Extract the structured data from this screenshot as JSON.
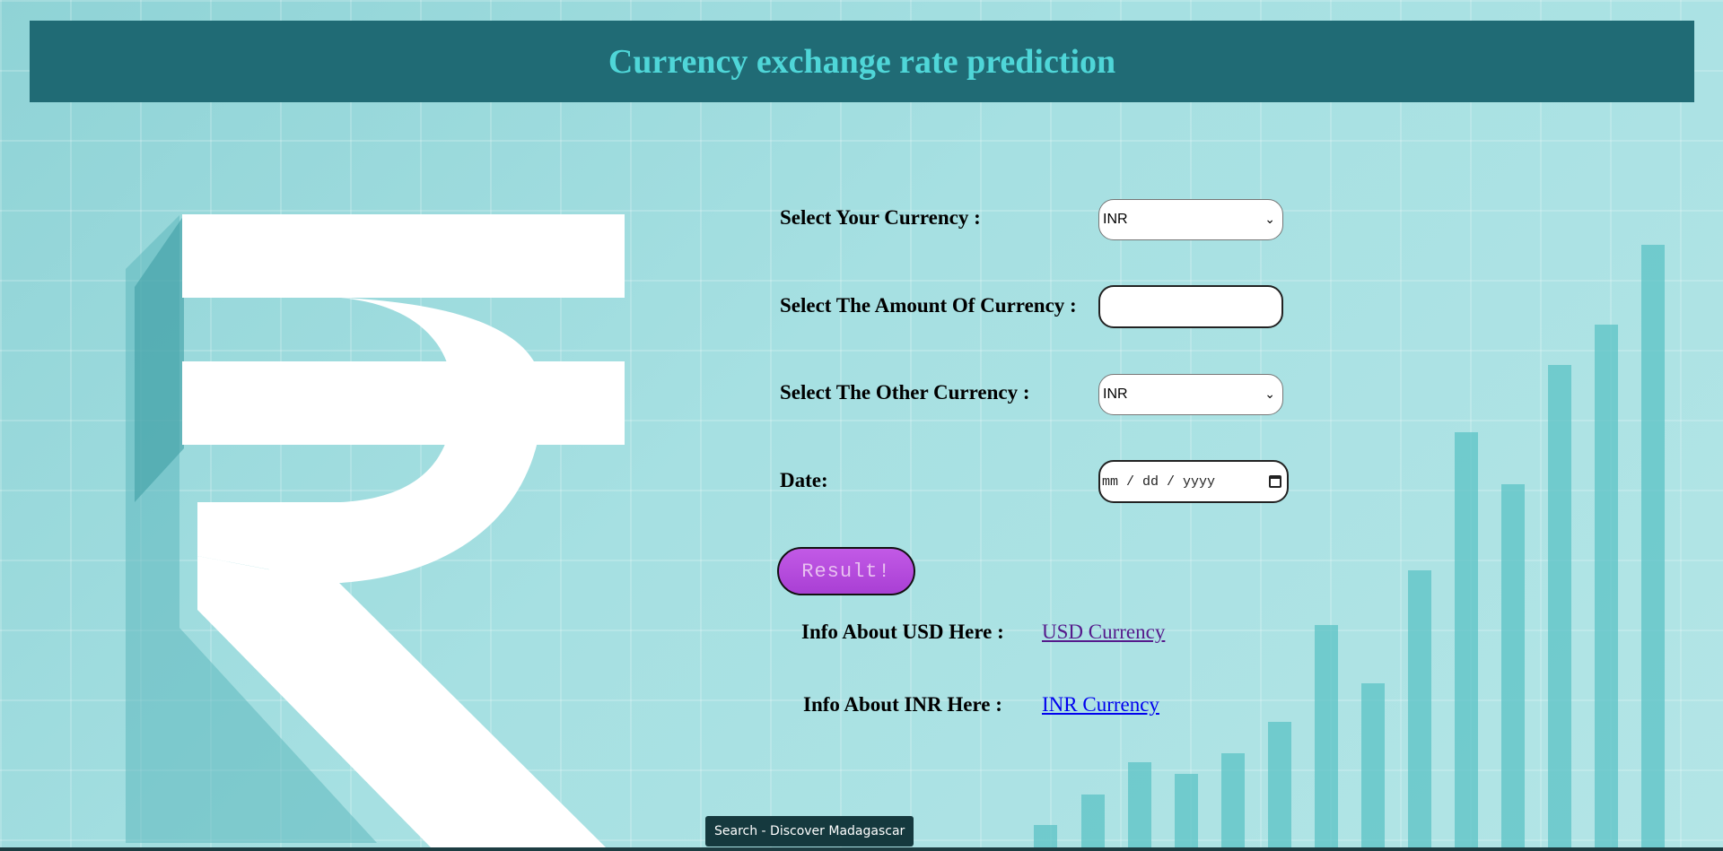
{
  "header": {
    "title": "Currency exchange rate prediction"
  },
  "form": {
    "from_currency": {
      "label": "Select Your Currency :",
      "value": "INR"
    },
    "amount": {
      "label": "Select The Amount Of Currency :",
      "value": ""
    },
    "to_currency": {
      "label": "Select The Other Currency :",
      "value": "INR"
    },
    "date": {
      "label": "Date:",
      "placeholder": "mm / dd / yyyy"
    },
    "submit_label": "Result!"
  },
  "info": [
    {
      "label": "Info About USD Here :",
      "link_text": "USD Currency"
    },
    {
      "label": "Info About INR Here :",
      "link_text": "INR Currency"
    }
  ],
  "tooltip": "Search - Discover Madagascar",
  "colors": {
    "header_bg": "#206b75",
    "header_text": "#4fd6d8",
    "button": "#b84ddf"
  }
}
